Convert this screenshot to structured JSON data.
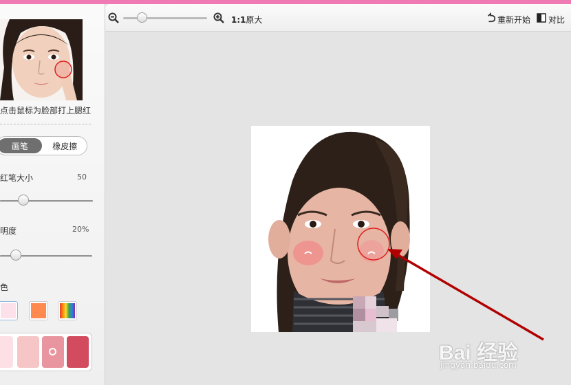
{
  "sidebar": {
    "hint": "点击鼠标为脸部打上腮红",
    "mode": {
      "brush": "画笔",
      "eraser": "橡皮擦"
    },
    "brush_size": {
      "label": "红笔大小",
      "value": "50",
      "level": 0.18
    },
    "opacity": {
      "label": "明度",
      "value": "20%",
      "level": 0.1
    },
    "color": {
      "label": "色"
    },
    "swatches": [
      "#fde1ea",
      "#ff8a50",
      "rainbow"
    ],
    "palette": [
      "#fde0e6",
      "#f6c6c6",
      "#e8959f",
      "#d24b5f"
    ]
  },
  "toolbar": {
    "zoom_level": 0.2,
    "actual_size_mark": "1:1",
    "actual_size_text": "原大",
    "restart": "重新开始",
    "compare": "对比"
  },
  "watermark": {
    "logo": "Bai 经验",
    "url": "jingyan.baidu.com"
  },
  "colors": {
    "accent": "#f07ab4",
    "brush_circle": "#e02020",
    "arrow": "#b00000"
  }
}
